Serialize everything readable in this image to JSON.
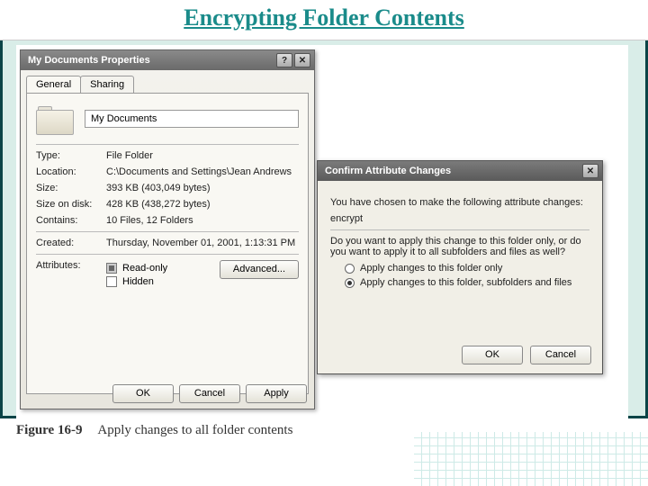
{
  "slide": {
    "title": "Encrypting Folder Contents"
  },
  "dlg1": {
    "title": "My Documents Properties",
    "tabs": [
      "General",
      "Sharing"
    ],
    "folder_name": "My Documents",
    "rows": {
      "type_label": "Type:",
      "type_value": "File Folder",
      "location_label": "Location:",
      "location_value": "C:\\Documents and Settings\\Jean Andrews",
      "size_label": "Size:",
      "size_value": "393 KB (403,049 bytes)",
      "sizeondisk_label": "Size on disk:",
      "sizeondisk_value": "428 KB (438,272 bytes)",
      "contains_label": "Contains:",
      "contains_value": "10 Files, 12 Folders",
      "created_label": "Created:",
      "created_value": "Thursday, November 01, 2001, 1:13:31 PM",
      "attributes_label": "Attributes:"
    },
    "checks": {
      "readonly": "Read-only",
      "hidden": "Hidden"
    },
    "advanced_btn": "Advanced...",
    "buttons": {
      "ok": "OK",
      "cancel": "Cancel",
      "apply": "Apply"
    }
  },
  "dlg2": {
    "title": "Confirm Attribute Changes",
    "lead": "You have chosen to make the following attribute changes:",
    "change": "encrypt",
    "question": "Do you want to apply this change to this folder only, or do you want to apply it to all subfolders and files as well?",
    "opt1": "Apply changes to this folder only",
    "opt2": "Apply changes to this folder, subfolders and files",
    "buttons": {
      "ok": "OK",
      "cancel": "Cancel"
    }
  },
  "caption": {
    "fig": "Figure 16-9",
    "text": "Apply changes to all folder contents"
  }
}
